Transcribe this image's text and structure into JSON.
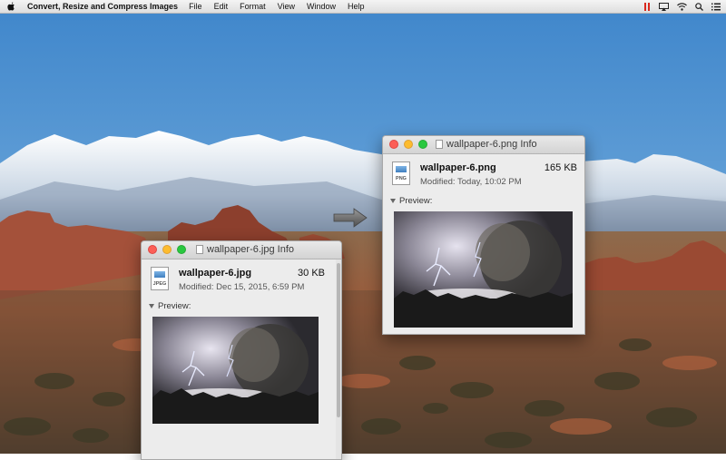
{
  "menubar": {
    "app_name": "Convert, Resize and Compress Images",
    "menus": [
      "File",
      "Edit",
      "Format",
      "View",
      "Window",
      "Help"
    ],
    "status_icons": [
      "pause-icon",
      "airplay-icon",
      "wifi-icon",
      "search-icon",
      "list-icon"
    ]
  },
  "windows": {
    "jpg": {
      "title": "wallpaper-6.jpg Info",
      "file_name": "wallpaper-6.jpg",
      "file_size": "30 KB",
      "modified": "Modified: Dec 15, 2015, 6:59 PM",
      "icon_format": "JPEG",
      "preview_label": "Preview:"
    },
    "png": {
      "title": "wallpaper-6.png Info",
      "file_name": "wallpaper-6.png",
      "file_size": "165 KB",
      "modified": "Modified: Today, 10:02 PM",
      "icon_format": "PNG",
      "preview_label": "Preview:"
    }
  },
  "colors": {
    "sky": "#4b8fd0",
    "status_red": "#d9281d"
  }
}
